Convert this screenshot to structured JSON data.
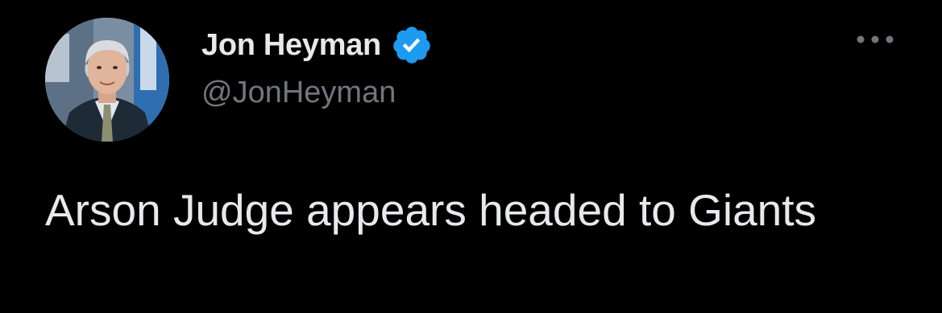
{
  "tweet": {
    "author": {
      "display_name": "Jon Heyman",
      "handle": "@JonHeyman",
      "verified": true,
      "avatar_icon": "profile-photo"
    },
    "text": "Arson Judge appears headed to Giants",
    "more_icon": "more-horizontal-icon"
  },
  "colors": {
    "background": "#000000",
    "primary_text": "#e7e9ea",
    "secondary_text": "#71767b",
    "verified_blue": "#1d9bf0"
  }
}
